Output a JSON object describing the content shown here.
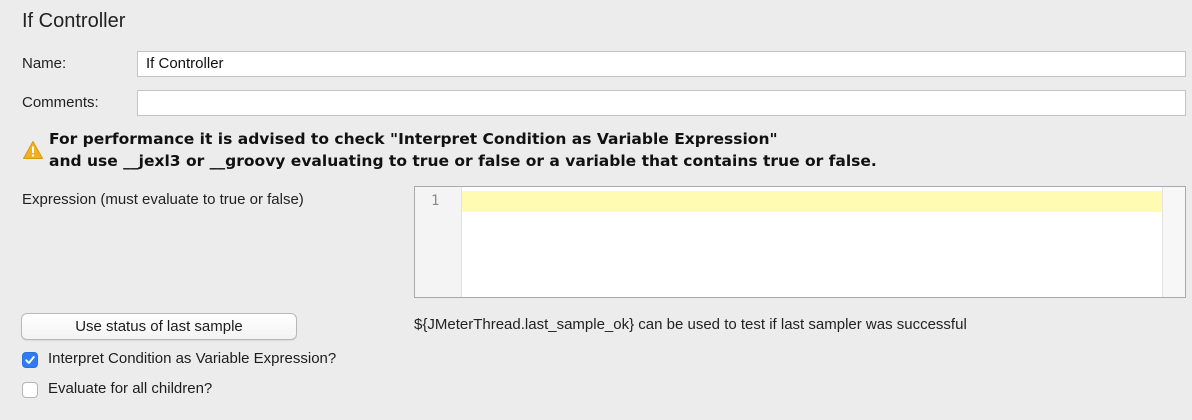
{
  "panel": {
    "title": "If Controller"
  },
  "fields": {
    "name_label": "Name:",
    "name_value": "If Controller",
    "comments_label": "Comments:",
    "comments_value": ""
  },
  "warning": {
    "icon": "warning-triangle-icon",
    "line1": "For performance it is advised to check \"Interpret Condition as Variable Expression\"",
    "line2": "and use __jexl3 or __groovy evaluating to true or false or a variable that contains true or false."
  },
  "expression": {
    "label": "Expression (must evaluate to true or false)",
    "line_numbers": [
      "1"
    ],
    "content": ""
  },
  "last_sample": {
    "button_label": "Use status of last sample",
    "hint": "${JMeterThread.last_sample_ok} can be used to test if last sampler was successful"
  },
  "options": {
    "interpret_label": "Interpret Condition as Variable Expression?",
    "interpret_checked": true,
    "evaluate_all_label": "Evaluate for all children?",
    "evaluate_all_checked": false
  },
  "colors": {
    "accent": "#2f7bf5",
    "current_line": "#fffbb3",
    "warning_icon": "#f2b01e"
  }
}
